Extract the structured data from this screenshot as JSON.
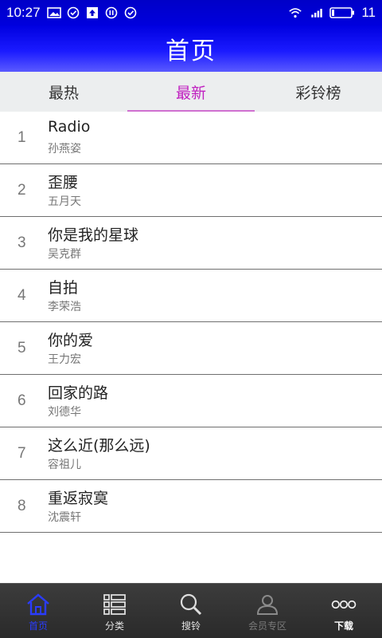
{
  "status_bar": {
    "time": "10:27",
    "battery_level": "11"
  },
  "header": {
    "title": "首页"
  },
  "tabs": [
    {
      "label": "最热",
      "active": false
    },
    {
      "label": "最新",
      "active": true
    },
    {
      "label": "彩铃榜",
      "active": false
    }
  ],
  "songs": [
    {
      "rank": "1",
      "title": "Radio",
      "artist": "孙燕姿"
    },
    {
      "rank": "2",
      "title": "歪腰",
      "artist": "五月天"
    },
    {
      "rank": "3",
      "title": "你是我的星球",
      "artist": "吴克群"
    },
    {
      "rank": "4",
      "title": "自拍",
      "artist": "李荣浩"
    },
    {
      "rank": "5",
      "title": "你的爱",
      "artist": "王力宏"
    },
    {
      "rank": "6",
      "title": "回家的路",
      "artist": "刘德华"
    },
    {
      "rank": "7",
      "title": "这么近(那么远)",
      "artist": "容祖儿"
    },
    {
      "rank": "8",
      "title": "重返寂寞",
      "artist": "沈震轩"
    }
  ],
  "bottom_nav": [
    {
      "label": "首页",
      "icon": "home-icon"
    },
    {
      "label": "分类",
      "icon": "grid-list-icon"
    },
    {
      "label": "搜铃",
      "icon": "search-icon"
    },
    {
      "label": "会员专区",
      "icon": "user-icon"
    },
    {
      "label": "下载",
      "icon": "more-dots-icon"
    }
  ],
  "colors": {
    "accent": "#c020c0",
    "header_blue": "#0000e0",
    "nav_active": "#2a3cff"
  }
}
